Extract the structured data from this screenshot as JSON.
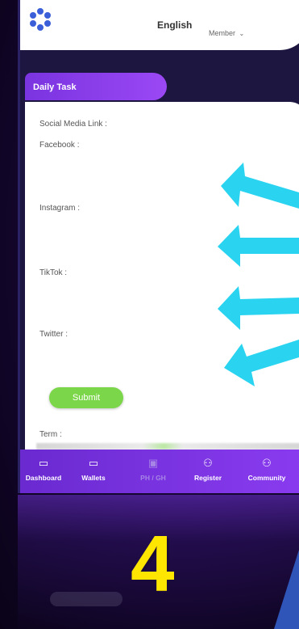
{
  "header": {
    "language": "English",
    "member_label": "Member",
    "member_chevron": "⌄"
  },
  "task": {
    "tab_title": "Daily Task",
    "social_media_label": "Social Media Link :",
    "fields": [
      {
        "label": "Facebook :"
      },
      {
        "label": "Instagram :"
      },
      {
        "label": "TikTok :"
      },
      {
        "label": "Twitter :"
      }
    ],
    "submit_label": "Submit",
    "term_label": "Term :"
  },
  "nav": {
    "items": [
      {
        "label": "Dashboard",
        "icon": "monitor-icon"
      },
      {
        "label": "Wallets",
        "icon": "wallet-icon"
      },
      {
        "label": "PH / GH",
        "icon": "qr-icon"
      },
      {
        "label": "Register",
        "icon": "user-add-icon"
      },
      {
        "label": "Community",
        "icon": "community-icon"
      }
    ]
  },
  "overlay": {
    "step_number": "4",
    "step_color": "#ffe600",
    "arrow_color": "#2ad4f0"
  },
  "colors": {
    "accent": "#8a3cf0",
    "submit": "#7cd64a",
    "background": "#14062e"
  }
}
